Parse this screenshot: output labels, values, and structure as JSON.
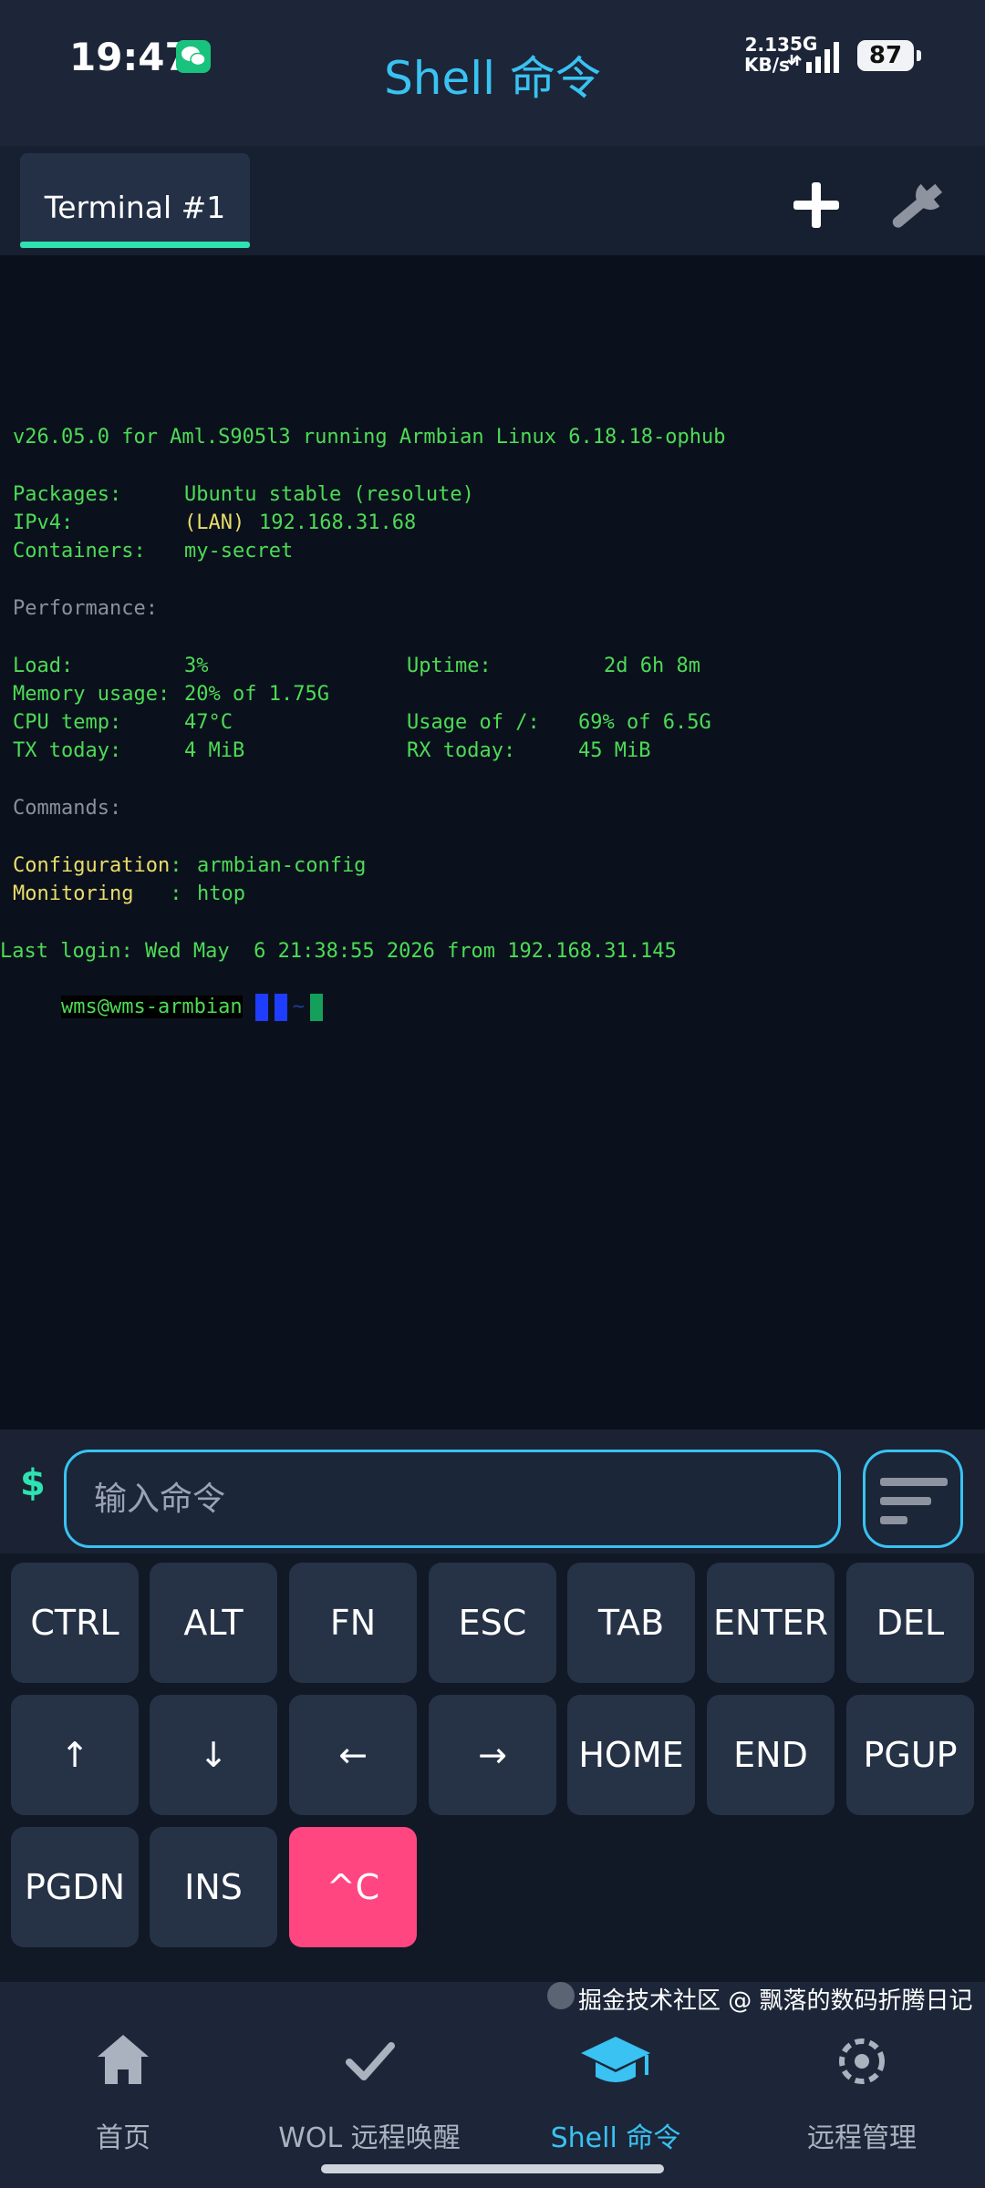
{
  "status_bar": {
    "time": "19:47",
    "net_speed_value": "2.13",
    "net_speed_unit": "KB/s",
    "network": "5G",
    "battery": "87"
  },
  "header": {
    "title": "Shell 命令"
  },
  "tabs": [
    {
      "label": "Terminal #1",
      "active": true
    }
  ],
  "terminal": {
    "banner": "v26.05.0 for Aml.S905l3 running Armbian Linux 6.18.18-ophub",
    "packages_label": "Packages:",
    "packages_value": "Ubuntu stable (resolute)",
    "ipv4_label": "IPv4:",
    "ipv4_tag": "(LAN)",
    "ipv4_value": "192.168.31.68",
    "containers_label": "Containers:",
    "containers_value": "my-secret",
    "performance_label": "Performance:",
    "load_label": "Load:",
    "load_value": "3%",
    "uptime_label": "Uptime:",
    "uptime_value": "2d 6h 8m",
    "memory_label": "Memory usage:",
    "memory_value": "20% of 1.75G",
    "cpu_label": "CPU temp:",
    "cpu_value": "47°C",
    "disk_label": "Usage of /:",
    "disk_value": "69% of 6.5G",
    "tx_label": "TX today:",
    "tx_value": "4 MiB",
    "rx_label": "RX today:",
    "rx_value": "45 MiB",
    "commands_label": "Commands:",
    "config_label": "Configuration",
    "config_value": "armbian-config",
    "monitoring_label": "Monitoring",
    "monitoring_value": "htop",
    "last_login": "Last login: Wed May  6 21:38:55 2026 from 192.168.31.145",
    "prompt_user": "wms@wms-armbian",
    "prompt_tail": "~"
  },
  "command_bar": {
    "prompt_symbol": "$",
    "placeholder": "输入命令",
    "value": ""
  },
  "extra_keys": [
    "CTRL",
    "ALT",
    "FN",
    "ESC",
    "TAB",
    "ENTER",
    "DEL",
    "↑",
    "↓",
    "←",
    "→",
    "HOME",
    "END",
    "PGUP",
    "PGDN",
    "INS",
    "^C"
  ],
  "bottom_nav": [
    {
      "label": "首页",
      "icon": "home-icon"
    },
    {
      "label": "WOL 远程唤醒",
      "icon": "check-icon"
    },
    {
      "label": "Shell 命令",
      "icon": "graduation-cap-icon",
      "active": true
    },
    {
      "label": "远程管理",
      "icon": "remote-manage-icon"
    }
  ],
  "watermark": "掘金技术社区 @ 飘落的数码折腾日记",
  "colors": {
    "accent": "#39c2f2",
    "tab_underline": "#2ee2b1",
    "terminal_green": "#4ddb56",
    "terminal_yellow": "#e9dd6a",
    "ctrl_c_key": "#ff4680"
  }
}
